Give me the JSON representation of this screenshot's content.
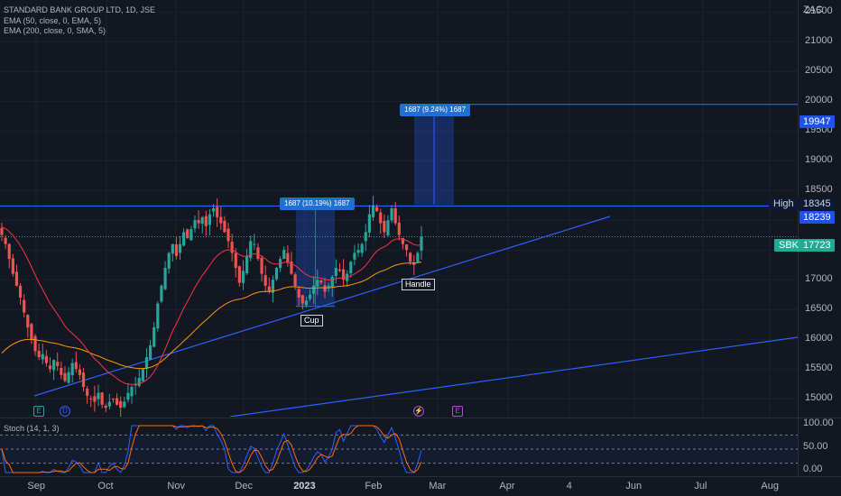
{
  "header": {
    "title": "STANDARD BANK GROUP LTD, 1D, JSE",
    "indicator1": "EMA (50, close, 0, EMA, 5)",
    "indicator2": "EMA (200, close, 0, SMA, 5)",
    "stoch": "Stoch (14, 1, 3)"
  },
  "currency": "ZAC",
  "price_axis": [
    "21500",
    "21000",
    "20500",
    "20000",
    "19500",
    "19000",
    "18500",
    "18000",
    "17500",
    "17000",
    "16500",
    "16000",
    "15500",
    "15000"
  ],
  "stoch_axis": [
    "100.00",
    "50.00",
    "0.00"
  ],
  "time_axis": [
    "Sep",
    "Oct",
    "Nov",
    "Dec",
    "2023",
    "Feb",
    "Mar",
    "Apr",
    "4",
    "Jun",
    "Jul",
    "Aug"
  ],
  "tags": {
    "target": "19947",
    "high_label": "High",
    "high_value": "18345",
    "resistance": "18239",
    "symbol": "SBK",
    "last_price": "17723"
  },
  "measures": {
    "first": "1687 (10.19%) 1687",
    "second": "1687 (9.24%) 1687"
  },
  "patterns": {
    "cup": "Cup",
    "handle": "Handle"
  },
  "events": {
    "e1": "E",
    "d": "D",
    "e2": "E",
    "e3": "E"
  },
  "colors": {
    "bg": "#131722",
    "up": "#26a69a",
    "down": "#ef5350",
    "line": "#2962ff",
    "ema50": "#f23645",
    "ema200": "#ff9800",
    "stochK": "#2962ff",
    "stochD": "#ff6d00"
  },
  "chart_data": {
    "type": "candlestick",
    "title": "STANDARD BANK GROUP LTD, 1D, JSE",
    "ylim": [
      14700,
      21700
    ],
    "price_levels": {
      "resistance": 18239,
      "target": 19947,
      "high": 18345,
      "last": 17723
    },
    "measurement_ranges": [
      {
        "label": "1687 (10.19%) 1687",
        "from": 16552,
        "to": 18239
      },
      {
        "label": "1687 (9.24%) 1687",
        "from": 18260,
        "to": 19947
      }
    ],
    "closes": [
      17750,
      17600,
      17350,
      17100,
      16900,
      16700,
      16450,
      16200,
      16000,
      15800,
      15700,
      15750,
      15600,
      15500,
      15650,
      15550,
      15400,
      15300,
      15450,
      15600,
      15500,
      15400,
      15200,
      15050,
      15000,
      14950,
      15100,
      14900,
      14850,
      14950,
      15000,
      14900,
      14850,
      14950,
      15100,
      15200,
      15250,
      15350,
      15500,
      15700,
      15900,
      16200,
      16600,
      16900,
      17200,
      17450,
      17600,
      17400,
      17600,
      17800,
      17700,
      17850,
      18000,
      17950,
      18050,
      17900,
      18100,
      18200,
      18050,
      17950,
      17800,
      17650,
      17450,
      17200,
      16950,
      17150,
      17400,
      17650,
      17600,
      17350,
      17100,
      16900,
      16800,
      17000,
      17200,
      17350,
      17500,
      17300,
      17100,
      16900,
      16700,
      16600,
      16650,
      16750,
      16900,
      17000,
      16950,
      16800,
      16900,
      17050,
      17200,
      17150,
      17000,
      17100,
      17300,
      17450,
      17500,
      17600,
      17800,
      18100,
      18250,
      18150,
      17950,
      17800,
      18000,
      18200,
      17950,
      17750,
      17600,
      17500,
      17300,
      17250,
      17450,
      17723
    ]
  }
}
